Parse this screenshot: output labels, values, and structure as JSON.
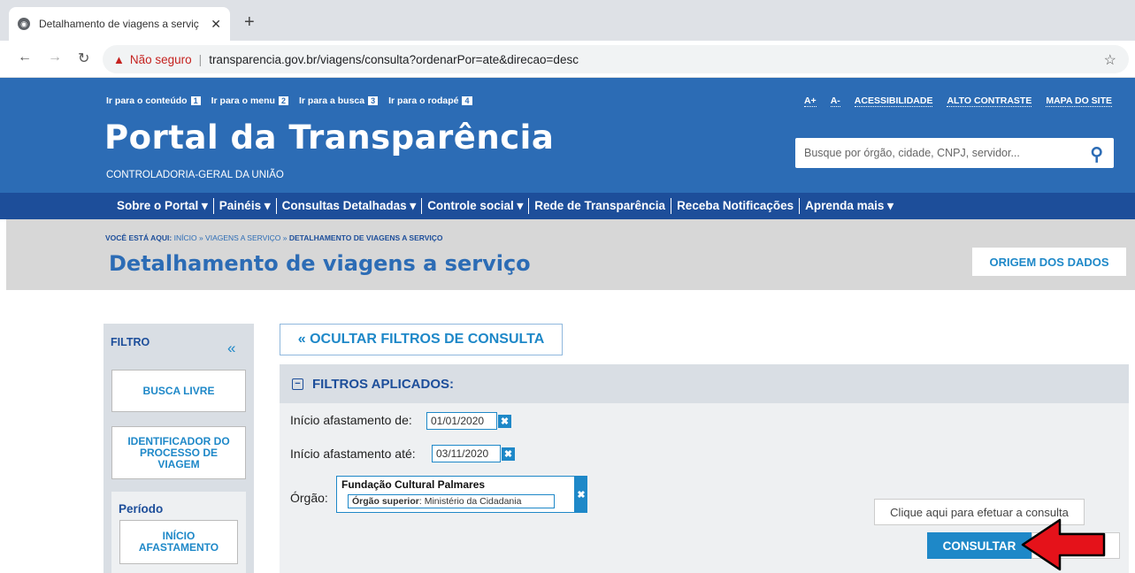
{
  "browser": {
    "tab_title": "Detalhamento de viagens a serviç",
    "not_secure": "Não seguro",
    "url": "transparencia.gov.br/viagens/consulta?ordenarPor=ate&direcao=desc"
  },
  "header": {
    "skip_links": [
      {
        "label": "Ir para o conteúdo",
        "key": "1"
      },
      {
        "label": "Ir para o menu",
        "key": "2"
      },
      {
        "label": "Ir para a busca",
        "key": "3"
      },
      {
        "label": "Ir para o rodapé",
        "key": "4"
      }
    ],
    "access_links": [
      "A+",
      "A-",
      "ACESSIBILIDADE",
      "ALTO CONTRASTE",
      "MAPA DO SITE"
    ],
    "brand": "Portal da Transparência",
    "subbrand": "CONTROLADORIA-GERAL DA UNIÃO",
    "search_placeholder": "Busque por órgão, cidade, CNPJ, servidor..."
  },
  "nav": [
    "Sobre o Portal ▾",
    "Painéis ▾",
    "Consultas Detalhadas ▾",
    "Controle social ▾",
    "Rede de Transparência",
    "Receba Notificações",
    "Aprenda mais ▾"
  ],
  "breadcrumb": {
    "prefix": "VOCÊ ESTÁ AQUI:",
    "path": "INÍCIO » VIAGENS A SERVIÇO »",
    "current": "DETALHAMENTO DE VIAGENS A SERVIÇO"
  },
  "page_title": "Detalhamento de viagens a serviço",
  "origem_button": "ORIGEM DOS DADOS",
  "filter_panel": {
    "title": "FILTRO",
    "collapse": "«",
    "busca_livre": "BUSCA LIVRE",
    "identificador": "IDENTIFICADOR DO PROCESSO DE VIAGEM",
    "period_title": "Período",
    "inicio_afastamento": "INÍCIO AFASTAMENTO"
  },
  "hide_filters": "« OCULTAR FILTROS DE CONSULTA",
  "applied": {
    "title": "FILTROS APLICADOS:",
    "inicio_de_label": "Início afastamento de:",
    "inicio_de_value": "01/01/2020",
    "inicio_ate_label": "Início afastamento até:",
    "inicio_ate_value": "03/11/2020",
    "orgao_label": "Órgão:",
    "orgao_name": "Fundação Cultural Palmares",
    "orgao_superior_label": "Órgão superior",
    "orgao_superior_value": ": Ministério da Cidadania",
    "tooltip": "Clique aqui para efetuar a consulta",
    "consultar": "CONSULTAR"
  },
  "colors": {
    "header": "#2c6cb5",
    "nav": "#1d4e9a",
    "accent": "#1e88c8",
    "arrow": "#e5121a"
  }
}
